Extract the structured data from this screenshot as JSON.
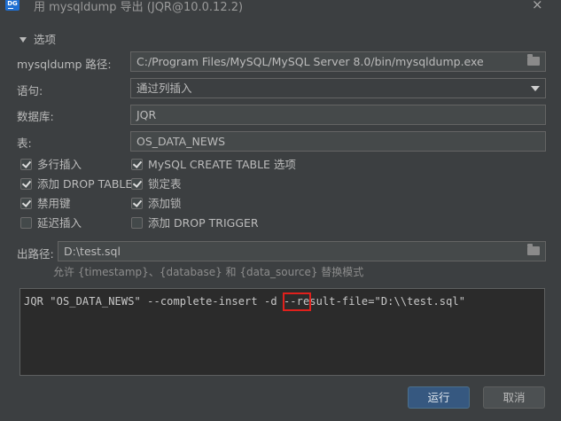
{
  "window": {
    "app_icon": "DG",
    "title": "用 mysqldump 导出 (JQR@10.0.12.2)",
    "close_icon": "×"
  },
  "section": {
    "label": "选项"
  },
  "fields": {
    "mysqldump_path": {
      "label": "mysqldump 路径:",
      "value": "C:/Program Files/MySQL/MySQL Server 8.0/bin/mysqldump.exe"
    },
    "statement": {
      "label": "语句:",
      "value": "通过列插入"
    },
    "database": {
      "label": "数据库:",
      "value": "JQR"
    },
    "table": {
      "label": "表:",
      "value": "OS_DATA_NEWS"
    },
    "output_path": {
      "label": "出路径:",
      "value": "D:\\test.sql"
    }
  },
  "checkboxes": {
    "left": [
      {
        "label": "多行插入",
        "checked": true
      },
      {
        "label": "添加 DROP TABLE",
        "checked": true
      },
      {
        "label": "禁用键",
        "checked": true
      },
      {
        "label": "延迟插入",
        "checked": false
      }
    ],
    "right": [
      {
        "label": "MySQL CREATE TABLE 选项",
        "checked": true
      },
      {
        "label": "锁定表",
        "checked": true
      },
      {
        "label": "添加锁",
        "checked": true
      },
      {
        "label": "添加 DROP TRIGGER",
        "checked": false
      }
    ]
  },
  "hint": "允许 {timestamp}、{database} 和 {data_source} 替换模式",
  "command": "JQR \"OS_DATA_NEWS\" --complete-insert -d --result-file=\"D:\\\\test.sql\"",
  "buttons": {
    "run": "运行",
    "cancel": "取消"
  }
}
